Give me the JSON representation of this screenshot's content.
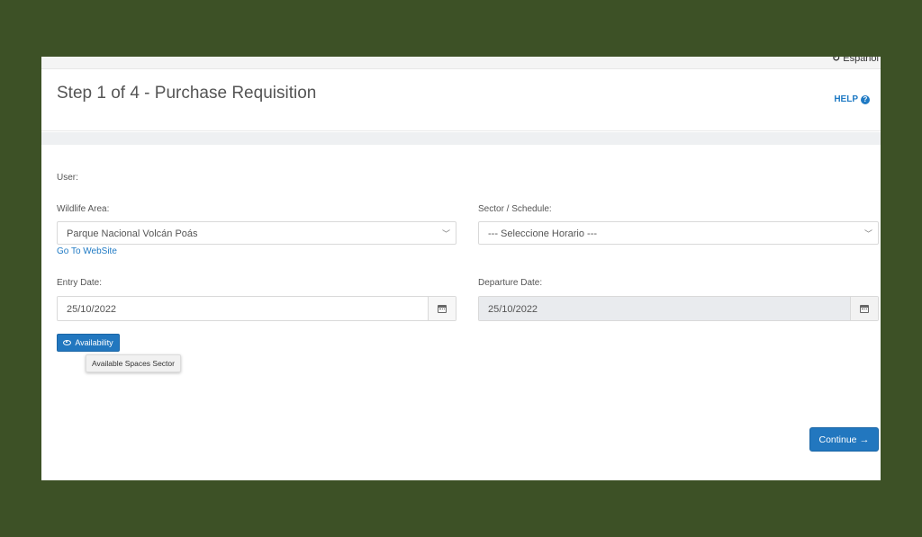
{
  "language": {
    "label": "Español",
    "icon": "refresh-icon"
  },
  "header": {
    "title": "Step 1 of 4 - Purchase Requisition",
    "help_label": "HELP",
    "help_icon": "question-circle-icon"
  },
  "form": {
    "user_label": "User:",
    "wildlife_area_label": "Wildlife Area:",
    "wildlife_area_value": "Parque Nacional Volcán Poás",
    "website_link": "Go To WebSite",
    "sector_label": "Sector / Schedule:",
    "sector_value": "--- Seleccione Horario ---",
    "entry_date_label": "Entry Date:",
    "entry_date_value": "25/10/2022",
    "departure_date_label": "Departure Date:",
    "departure_date_value": "25/10/2022",
    "availability_button": "Availability",
    "availability_tooltip": "Available Spaces Sector",
    "continue_button": "Continue"
  },
  "colors": {
    "background": "#3d5126",
    "primary": "#2277bf",
    "link": "#1f7ac4",
    "disabled_field": "#e9ebee"
  }
}
